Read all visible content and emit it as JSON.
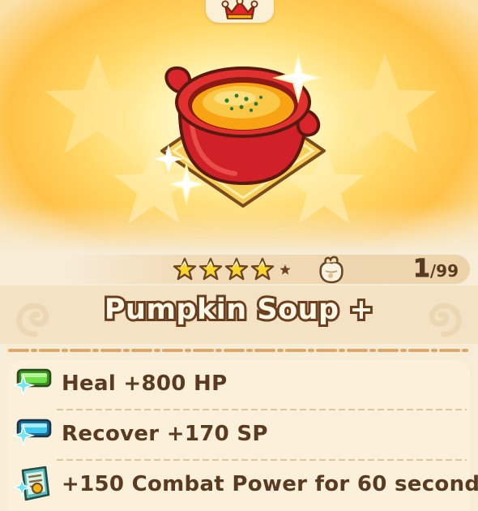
{
  "item": {
    "name": "Pumpkin Soup +",
    "rarity_stars": 4,
    "max_stars": 5,
    "quantity": "1",
    "quantity_max": "/99"
  },
  "effects": [
    {
      "icon": "hp-gauge-icon",
      "text": "Heal +800 HP"
    },
    {
      "icon": "sp-gauge-icon",
      "text": "Recover +170 SP"
    },
    {
      "icon": "combat-power-scroll-icon",
      "text": "+150 Combat Power for 60 second"
    }
  ],
  "colors": {
    "glow": "#ffd766",
    "panel": "#fbf0da",
    "text_brown": "#5b3a22",
    "hp_green": "#49c92f",
    "sp_cyan": "#3ec8ef",
    "pot_red": "#d8262b"
  }
}
